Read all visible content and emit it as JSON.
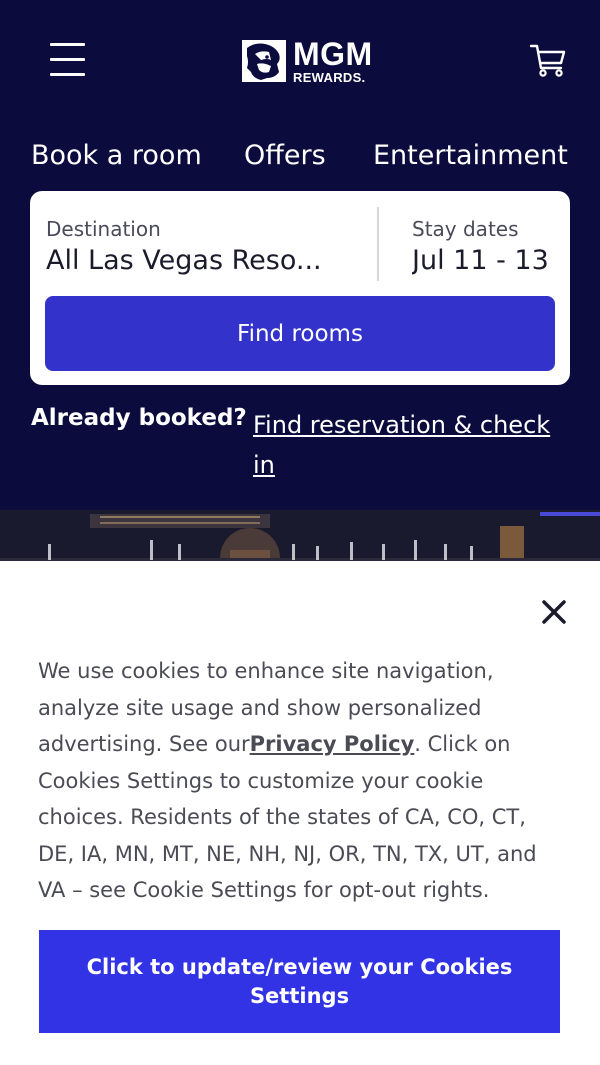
{
  "brand": {
    "name": "MGM",
    "subtitle": "REWARDS."
  },
  "header": {
    "menu_icon": "hamburger-menu-icon",
    "cart_icon": "shopping-cart-icon"
  },
  "nav": {
    "items": [
      {
        "label": "Book a room"
      },
      {
        "label": "Offers"
      },
      {
        "label": "Entertainment"
      }
    ]
  },
  "search": {
    "destination_label": "Destination",
    "destination_value": "All Las Vegas Reso...",
    "dates_label": "Stay dates",
    "dates_value": "Jul 11 - 13",
    "submit_label": "Find rooms"
  },
  "booking": {
    "already_booked": "Already booked?",
    "find_reservation": "Find reservation & check in"
  },
  "cookie_banner": {
    "close_icon": "close-icon",
    "text_before_link": "We use cookies to enhance site navigation, analyze site usage and show personalized advertising. See our",
    "link_text": "Privacy Policy",
    "text_after_link": ". Click on Cookies Settings to customize your cookie choices. Residents of the states of CA, CO, CT, DE, IA, MN, MT, NE, NH, NJ, OR, TN, TX, UT, and VA – see Cookie Settings for opt-out rights.",
    "button_label": "Click to update/review your Cookies Settings"
  },
  "colors": {
    "header_bg": "#0b0b3d",
    "primary_button": "#3333cc",
    "cookie_button": "#3333e6",
    "card_bg": "#ffffff"
  }
}
